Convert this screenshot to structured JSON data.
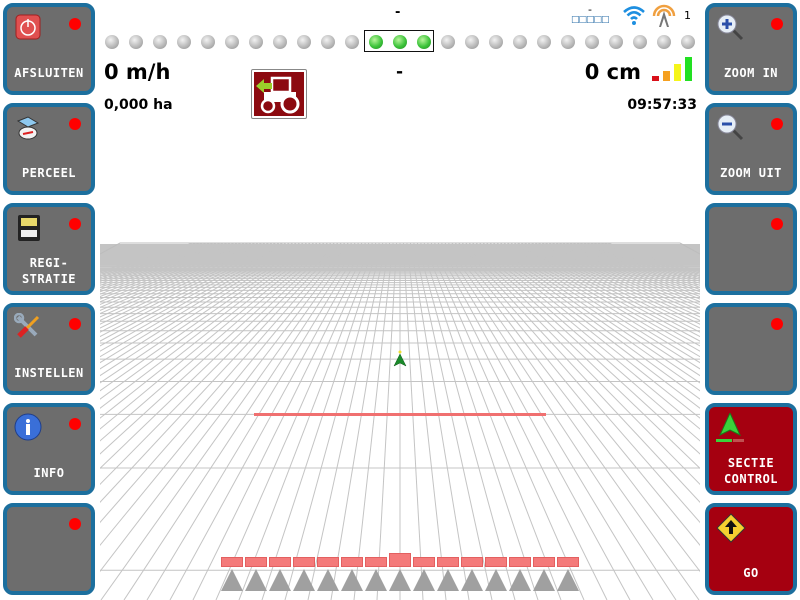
{
  "left_buttons": [
    {
      "label": "AFSLUITEN",
      "icon": "power-off-icon"
    },
    {
      "label": "PERCEEL",
      "icon": "field-compass-icon"
    },
    {
      "label_line1": "REGI-",
      "label_line2": "STRATIE",
      "icon": "memory-card-icon"
    },
    {
      "label": "INSTELLEN",
      "icon": "wrench-screwdriver-icon"
    },
    {
      "label": "INFO",
      "icon": "info-icon"
    },
    {
      "label": ""
    }
  ],
  "right_buttons": [
    {
      "label": "ZOOM IN",
      "icon": "zoom-in-icon"
    },
    {
      "label": "ZOOM UIT",
      "icon": "zoom-out-icon"
    },
    {
      "label": ""
    },
    {
      "label": ""
    },
    {
      "label_line1": "SECTIE",
      "label_line2": "CONTROL",
      "icon": "section-control-arrow-icon",
      "color": "#a50010"
    },
    {
      "label": "GO",
      "icon": "go-warning-icon",
      "color": "#a50010"
    }
  ],
  "status": {
    "top_center_text": "-",
    "center_text": "-",
    "speed": "0 m/h",
    "area": "0,000 ha",
    "offset": "0 cm",
    "time": "09:57:33",
    "gps_dash": "-",
    "gps_boxes": "□□□□□",
    "satellite_count": "1"
  },
  "lightbar": {
    "total_leds": 25,
    "active_leds": [
      12,
      13,
      14
    ]
  },
  "signal_bars": {
    "levels": 4,
    "colors": [
      "#d9101a",
      "#f5a020",
      "#f5f51a",
      "#22e022"
    ]
  },
  "sections": {
    "count": 15,
    "active_color": "#f47a7a",
    "center_index": 7
  },
  "colors": {
    "button_border": "#1c6f9e",
    "button_bg": "#6d6d6d",
    "button_active_bg": "#a50010",
    "indicator_red": "#ff0000",
    "led_green": "#3cc33a"
  }
}
